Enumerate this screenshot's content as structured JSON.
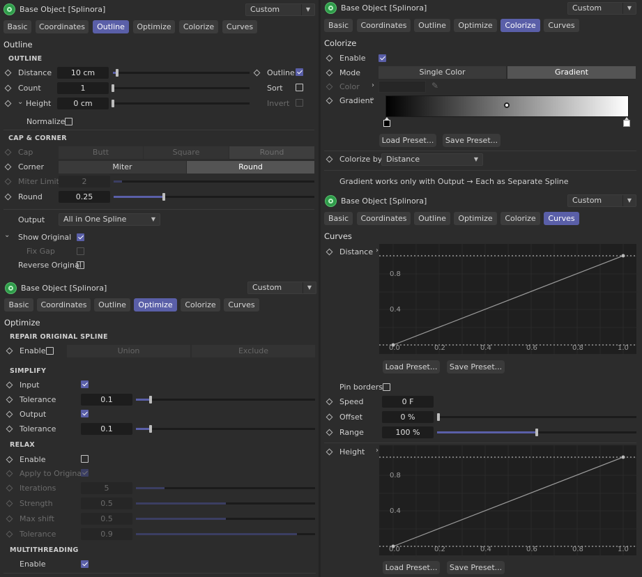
{
  "common": {
    "object_title": "Base Object [Splinora]",
    "preset": "Custom",
    "tabs": [
      "Basic",
      "Coordinates",
      "Outline",
      "Optimize",
      "Colorize",
      "Curves"
    ],
    "load_preset": "Load Preset...",
    "save_preset": "Save Preset..."
  },
  "outline": {
    "section": "Outline",
    "sub_outline": "OUTLINE",
    "distance_label": "Distance",
    "distance_value": "10 cm",
    "distance_level": 0.03,
    "outline_label": "Outline",
    "count_label": "Count",
    "count_value": "1",
    "sort_label": "Sort",
    "height_label": "Height",
    "height_value": "0 cm",
    "invert_label": "Invert",
    "normalize_label": "Normalize",
    "sub_cap": "CAP & CORNER",
    "cap_label": "Cap",
    "cap_options": [
      "Butt",
      "Square",
      "Round"
    ],
    "corner_label": "Corner",
    "corner_options": [
      "Miter",
      "Round"
    ],
    "miter_label": "Miter Limit",
    "miter_value": "2",
    "round_label": "Round",
    "round_value": "0.25",
    "round_level": 0.25,
    "output_label": "Output",
    "output_value": "All in One Spline",
    "show_original_label": "Show Original",
    "fix_gap_label": "Fix Gap",
    "reverse_label": "Reverse Original"
  },
  "optimize": {
    "section": "Optimize",
    "sub_repair": "REPAIR ORIGINAL SPLINE",
    "enable_label": "Enable",
    "repair_options": [
      "Union",
      "Exclude"
    ],
    "sub_simplify": "SIMPLIFY",
    "input_label": "Input",
    "tolerance_label": "Tolerance",
    "input_tol": "0.1",
    "input_tol_level": 0.08,
    "output_label": "Output",
    "output_tol": "0.1",
    "output_tol_level": 0.08,
    "sub_relax": "RELAX",
    "relax_enable_label": "Enable",
    "apply_label": "Apply to Original",
    "iterations_label": "Iterations",
    "iterations_value": "5",
    "iterations_level": 0.16,
    "strength_label": "Strength",
    "strength_value": "0.5",
    "strength_level": 0.5,
    "maxshift_label": "Max shift",
    "maxshift_value": "0.5",
    "maxshift_level": 0.5,
    "relax_tol_label": "Tolerance",
    "relax_tol_value": "0.9",
    "relax_tol_level": 0.9,
    "sub_mt": "MULTITHREADING",
    "mt_enable_label": "Enable"
  },
  "colorize": {
    "section": "Colorize",
    "enable_label": "Enable",
    "mode_label": "Mode",
    "mode_options": [
      "Single Color",
      "Gradient"
    ],
    "color_label": "Color",
    "gradient_label": "Gradient",
    "colorize_by_label": "Colorize by",
    "colorize_by_value": "Distance",
    "note": "Gradient works only with Output → Each as Separate Spline"
  },
  "curves": {
    "section": "Curves",
    "distance_label": "Distance",
    "pin_label": "Pin borders",
    "speed_label": "Speed",
    "speed_value": "0 F",
    "offset_label": "Offset",
    "offset_value": "0 %",
    "offset_level": 0.0,
    "range_label": "Range",
    "range_value": "100 %",
    "range_level": 0.5,
    "height_label": "Height",
    "x_ticks": [
      "0.0",
      "0.2",
      "0.4",
      "0.6",
      "0.8",
      "1.0"
    ],
    "y_ticks": [
      "0.4",
      "0.8"
    ]
  },
  "colors": {
    "accent": "#5a5fa8",
    "panel": "#2c2c2c",
    "field": "#1d1d1d"
  }
}
